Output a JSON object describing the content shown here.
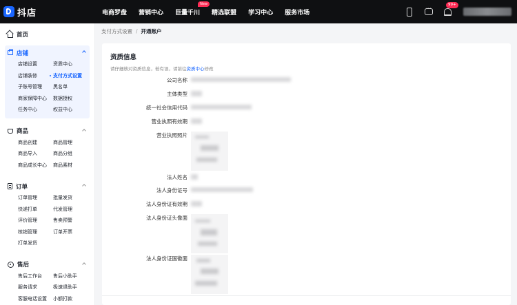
{
  "brand": {
    "logo_text": "抖店",
    "accent": "#1966ff"
  },
  "topnav": {
    "items": [
      "电商罗盘",
      "营销中心",
      "巨量千川",
      "精选联盟",
      "学习中心",
      "服务市场"
    ],
    "new_badge": "New",
    "notification_count": "99+"
  },
  "sidebar": {
    "home": "首页",
    "groups": [
      {
        "title": "店铺",
        "icon": "box-icon",
        "items": [
          "店铺设置",
          "资质中心",
          "店铺装修",
          "支付方式设置",
          "子账号管理",
          "黑名单",
          "商家保障中心",
          "数据授权",
          "任务中心",
          "权益中心"
        ]
      },
      {
        "title": "商品",
        "icon": "cart-icon",
        "items": [
          "商品创建",
          "商品管理",
          "商品导入",
          "商品分组",
          "商品成长中心",
          "商品素材"
        ]
      },
      {
        "title": "订单",
        "icon": "order-icon",
        "items": [
          "订单管理",
          "批量发货",
          "快递打单",
          "代发管理",
          "评价管理",
          "售卖预警",
          "核销管理",
          "订单开票",
          "打单发货"
        ]
      },
      {
        "title": "售后",
        "icon": "after-sale-icon",
        "items": [
          "售后工作台",
          "售后小助手",
          "服务请求",
          "极速退助手",
          "客服电话设置",
          "小额打款"
        ]
      }
    ],
    "current_item": "支付方式设置"
  },
  "breadcrumb": {
    "parent": "支付方式设置",
    "separator": "/",
    "current": "开通账户"
  },
  "card": {
    "title": "资质信息",
    "subtitle_prefix": "请仔细核对资质信息，若有误，请前往",
    "subtitle_link": "资质中心",
    "subtitle_suffix": "修改",
    "fields": {
      "company_name": "公司名称",
      "subject_type": "主体类型",
      "credit_code": "统一社会信用代码",
      "license_validity": "营业执照有效期",
      "license_photo": "营业执照照片",
      "legal_name": "法人姓名",
      "legal_id": "法人身份证号",
      "legal_id_validity": "法人身份证有效期",
      "id_front": "法人身份证头像面",
      "id_back": "法人身份证国徽面"
    }
  }
}
